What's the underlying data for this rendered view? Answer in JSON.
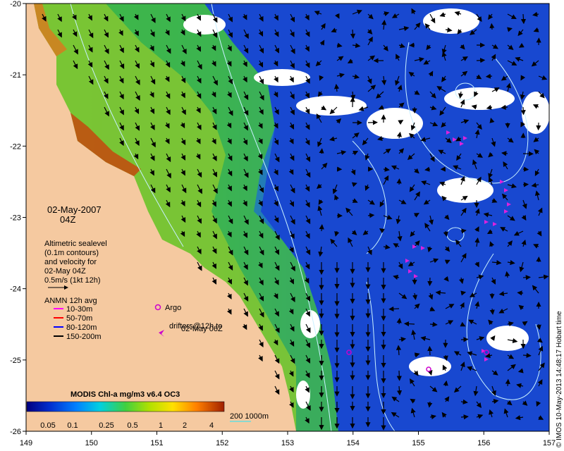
{
  "map": {
    "date_title": "02-May-2007",
    "time_title": "04Z",
    "x_ticks": [
      "149",
      "150",
      "151",
      "152",
      "153",
      "154",
      "155",
      "156",
      "157"
    ],
    "y_ticks": [
      "-20",
      "-21",
      "-22",
      "-23",
      "-24",
      "-25",
      "-26"
    ],
    "lon_range": [
      149,
      157
    ],
    "lat_range": [
      -26,
      -20
    ]
  },
  "altimetry_legend": {
    "lines": [
      "Altimetric sealevel",
      "(0.1m contours)",
      "and velocity for",
      "02-May 04Z",
      "0.5m/s (1kt 12h)"
    ]
  },
  "anmn_legend": {
    "title": "ANMN 12h avg",
    "items": [
      {
        "label": "10-30m",
        "color": "#ff00ff"
      },
      {
        "label": "50-70m",
        "color": "#ff0000"
      },
      {
        "label": "80-120m",
        "color": "#0000ff"
      },
      {
        "label": "150-200m",
        "color": "#000000"
      }
    ]
  },
  "argo_legend": {
    "argo_label": "Argo",
    "drifters_line1": "drifters@12h to",
    "drifters_line2": "02-May 06Z",
    "marker_color": "#cc00cc"
  },
  "colorbar": {
    "title": "MODIS Chl-a mg/m3 v6.4 OC3",
    "ticks": [
      "0.05",
      "0.1",
      "0.25",
      "0.5",
      "1",
      "2",
      "4"
    ]
  },
  "depth_legend": {
    "label": "200  1000m",
    "color": "#66dddd"
  },
  "credit": "© IMOS 10-May-2013 14:48:17 Hobart time",
  "colors": {
    "land": "#f5c9a0",
    "ocean_deep": "#1040c8",
    "shelf_green": "#3cb43c",
    "coast_yellow": "#d0d000",
    "cloud": "#ffffff",
    "contour": "#c8f0ff"
  }
}
